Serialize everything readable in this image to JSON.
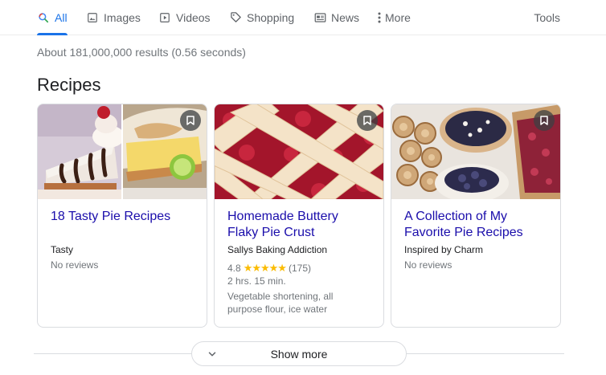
{
  "tabs": [
    {
      "label": "All",
      "icon": "search-icon",
      "active": true
    },
    {
      "label": "Images",
      "icon": "image-icon"
    },
    {
      "label": "Videos",
      "icon": "play-icon"
    },
    {
      "label": "Shopping",
      "icon": "tag-icon"
    },
    {
      "label": "News",
      "icon": "newspaper-icon"
    },
    {
      "label": "More",
      "icon": "more-vert-icon"
    }
  ],
  "tools_label": "Tools",
  "result_stats": "About 181,000,000 results (0.56 seconds)",
  "section_heading": "Recipes",
  "cards": [
    {
      "title": "18 Tasty Pie Recipes",
      "source": "Tasty",
      "reviews": "No reviews"
    },
    {
      "title": "Homemade Buttery Flaky Pie Crust",
      "source": "Sallys Baking Addiction",
      "rating_value": "4.8",
      "stars": "★★★★★",
      "rating_count": "(175)",
      "time": "2 hrs. 15 min.",
      "ingredients": "Vegetable shortening, all purpose flour, ice water"
    },
    {
      "title": "A Collection of My Favorite Pie Recipes",
      "source": "Inspired by Charm",
      "reviews": "No reviews"
    }
  ],
  "show_more_label": "Show more",
  "colors": {
    "accent": "#1a73e8",
    "link": "#1a0dab",
    "star": "#fbbc04",
    "muted": "#70757a"
  }
}
